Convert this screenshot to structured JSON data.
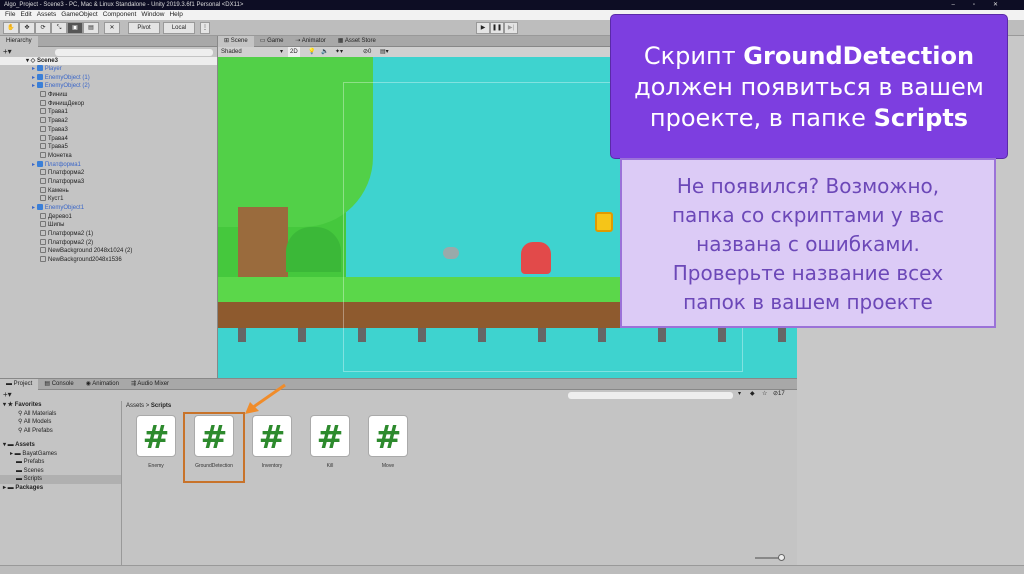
{
  "window": {
    "title": "Algo_Project - Scene3 - PC, Mac & Linux Standalone - Unity 2019.3.6f1 Personal <DX11>",
    "controls": [
      "–",
      "▫",
      "✕"
    ]
  },
  "menu": [
    "File",
    "Edit",
    "Assets",
    "GameObject",
    "Component",
    "Window",
    "Help"
  ],
  "toolbar": {
    "pivot": "Pivot",
    "local": "Local",
    "play": "▶",
    "pause": "❚❚",
    "step": "▶|"
  },
  "hierarchy": {
    "tab": "Hierarchy",
    "scene": "Scene3",
    "items": [
      {
        "label": "Player",
        "prefab": true
      },
      {
        "label": "EnemyObject (1)",
        "prefab": true
      },
      {
        "label": "EnemyObject (2)",
        "prefab": true
      },
      {
        "label": "Финиш",
        "prefab": false
      },
      {
        "label": "ФинишДекор",
        "prefab": false
      },
      {
        "label": "Трава1",
        "prefab": false
      },
      {
        "label": "Трава2",
        "prefab": false
      },
      {
        "label": "Трава3",
        "prefab": false
      },
      {
        "label": "Трава4",
        "prefab": false
      },
      {
        "label": "Трава5",
        "prefab": false
      },
      {
        "label": "Монетка",
        "prefab": false
      },
      {
        "label": "Платформа1",
        "prefab": true
      },
      {
        "label": "Платформа2",
        "prefab": false
      },
      {
        "label": "Платформа3",
        "prefab": false
      },
      {
        "label": "Камень",
        "prefab": false
      },
      {
        "label": "Куст1",
        "prefab": false
      },
      {
        "label": "EnemyObject1",
        "prefab": true
      },
      {
        "label": "Дерево1",
        "prefab": false
      },
      {
        "label": "Шипы",
        "prefab": false
      },
      {
        "label": "Платформа2 (1)",
        "prefab": false
      },
      {
        "label": "Платформа2 (2)",
        "prefab": false
      },
      {
        "label": "NewBackground 2048x1024 (2)",
        "prefab": false
      },
      {
        "label": "NewBackground2048x1536",
        "prefab": false
      }
    ]
  },
  "scene": {
    "tabs": [
      "Scene",
      "Game",
      "Animator",
      "Asset Store"
    ],
    "shading": "Shaded",
    "mode2d": "2D",
    "gizmo_count": "0"
  },
  "project": {
    "tabs": [
      "Project",
      "Console",
      "Animation",
      "Audio Mixer"
    ],
    "favorites": {
      "label": "Favorites",
      "items": [
        "All Materials",
        "All Models",
        "All Prefabs"
      ]
    },
    "assets": {
      "label": "Assets",
      "items": [
        "BayatGames",
        "Prefabs",
        "Scenes",
        "Scripts"
      ]
    },
    "packages": "Packages",
    "breadcrumb": [
      "Assets",
      "Scripts"
    ],
    "separator": ">",
    "count": "17",
    "scripts": [
      "Enemy",
      "GroundDetection",
      "Inventory",
      "Kill",
      "Move"
    ],
    "highlighted": "GroundDetection"
  },
  "callout": {
    "line1a": "Скрипт ",
    "line1b": "GroundDetection",
    "line2": "должен появиться в вашем",
    "line3a": "проекте, в папке ",
    "line3b": "Scripts"
  },
  "hint": {
    "lines": [
      "Не появился? Возможно,",
      "папка со скриптами у вас",
      "названа с ошибками.",
      "Проверьте название всех",
      "папок в вашем проекте"
    ]
  },
  "colors": {
    "callout": "#7d3ee0",
    "hint_bg": "#dccbf6",
    "highlight": "#c8732a",
    "arrow": "#f08c2a"
  }
}
